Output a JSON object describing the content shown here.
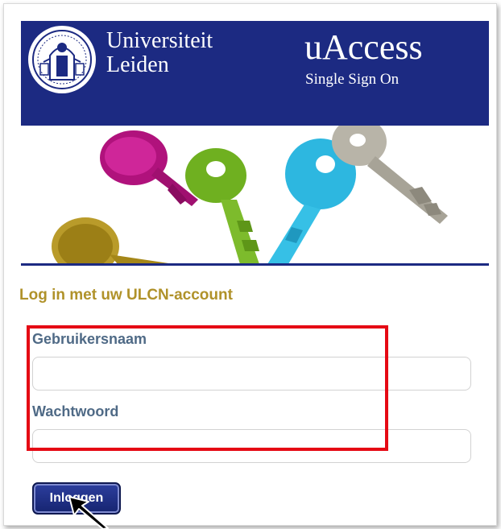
{
  "header": {
    "university_line1": "Universiteit",
    "university_line2": "Leiden",
    "app_title": "uAccess",
    "app_subtitle": "Single Sign On"
  },
  "login": {
    "heading": "Log in met uw ULCN-account",
    "username_label": "Gebruikersnaam",
    "username_value": "",
    "password_label": "Wachtwoord",
    "password_value": "",
    "submit_label": "Inloggen"
  },
  "colors": {
    "brand_blue": "#1c2a82",
    "heading_gold": "#b0922a",
    "label_slate": "#4f6a86",
    "highlight_red": "#e50914"
  },
  "icons": {
    "seal": "university-seal-icon",
    "cursor": "mouse-pointer-icon",
    "banner": "keys-banner-image"
  }
}
